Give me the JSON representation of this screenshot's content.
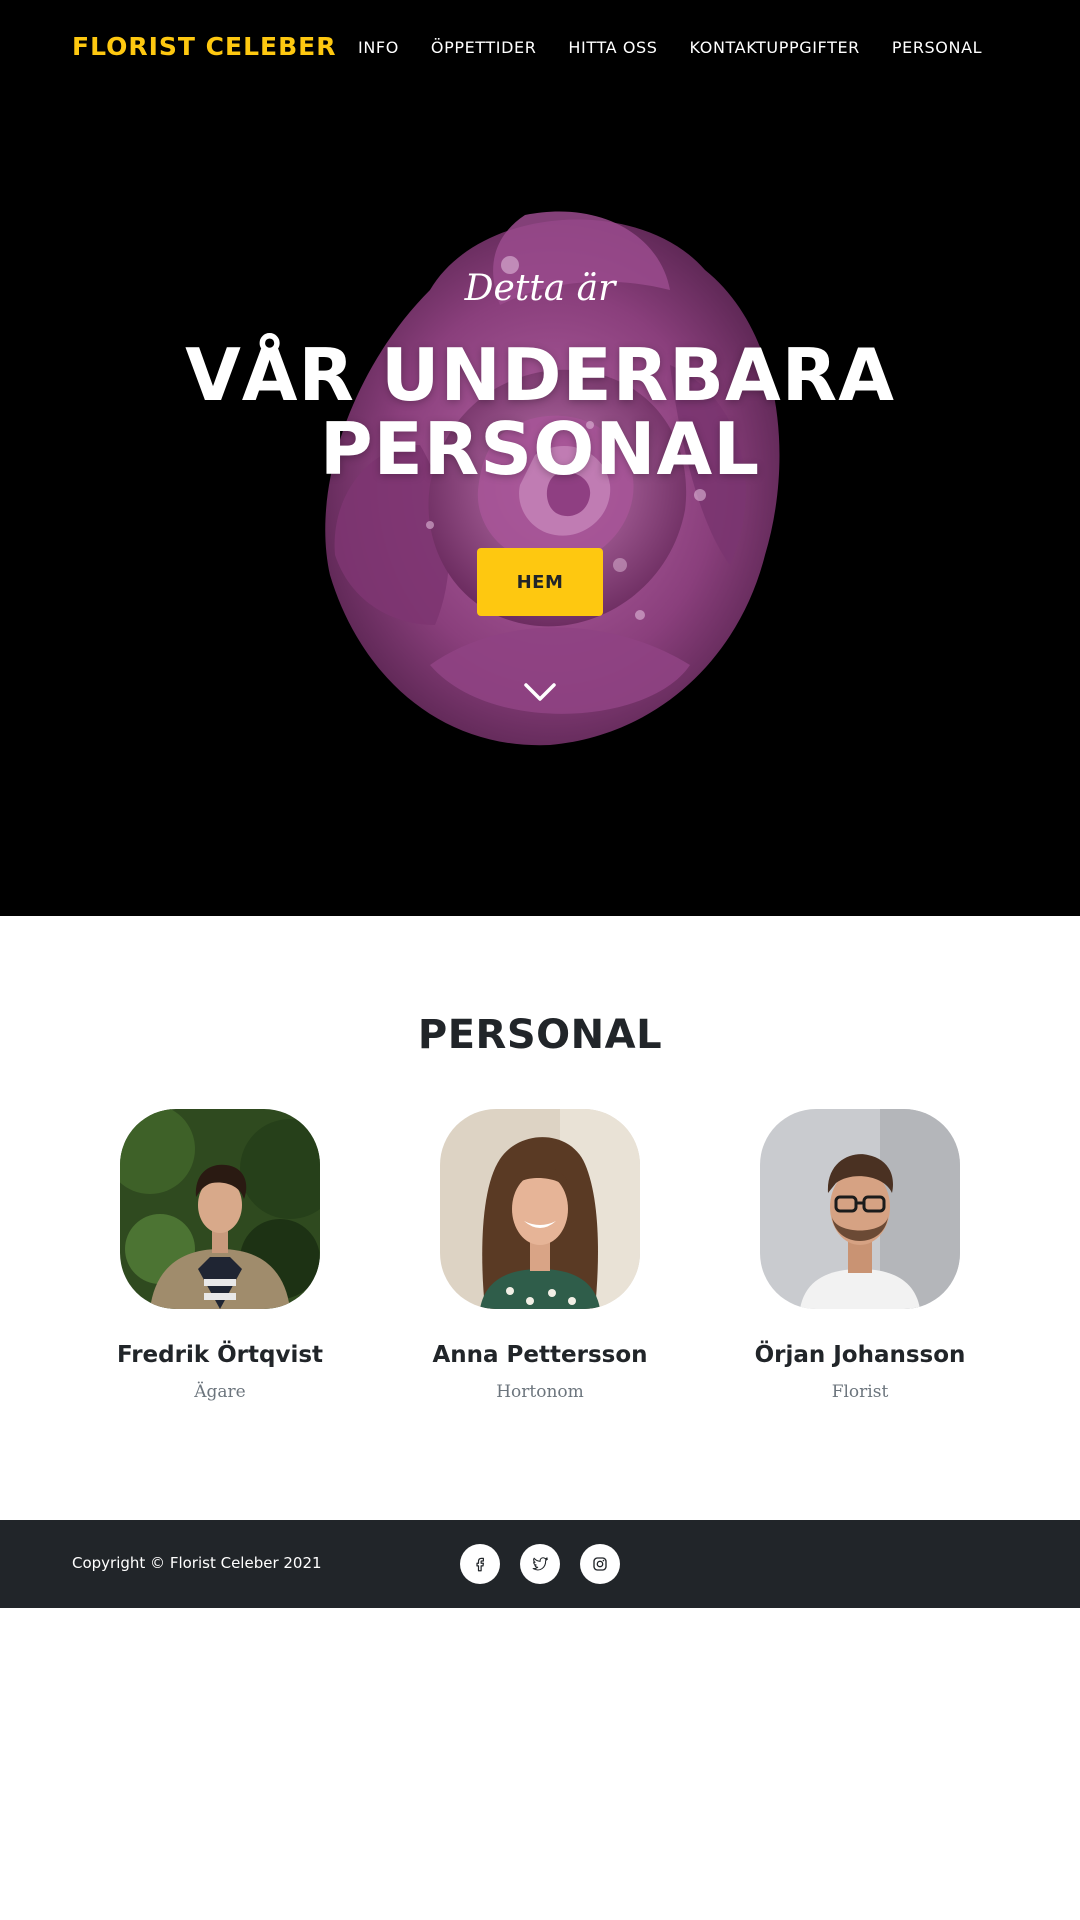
{
  "navbar": {
    "brand": "FLORIST CELEBER",
    "links": [
      {
        "label": "INFO"
      },
      {
        "label": "ÖPPETTIDER"
      },
      {
        "label": "HITTA OSS"
      },
      {
        "label": "KONTAKTUPPGIFTER"
      },
      {
        "label": "PERSONAL"
      }
    ]
  },
  "hero": {
    "subheading": "Detta är",
    "heading_line1": "VÅR UNDERBARA",
    "heading_line2": "PERSONAL",
    "button_label": "HEM",
    "background_image": "purple-rose",
    "scroll_icon": "chevron-down-icon"
  },
  "team": {
    "heading": "PERSONAL",
    "members": [
      {
        "name": "Fredrik Örtqvist",
        "role": "Ägare"
      },
      {
        "name": "Anna Pettersson",
        "role": "Hortonom"
      },
      {
        "name": "Örjan Johansson",
        "role": "Florist"
      }
    ]
  },
  "footer": {
    "copyright": "Copyright © Florist Celeber 2021",
    "social_icons": [
      "facebook-icon",
      "twitter-icon",
      "instagram-icon"
    ]
  },
  "colors": {
    "accent": "#fec810",
    "hero_background": "#000000",
    "footer_background": "#212529",
    "heading_text": "#212529",
    "muted_text": "#6c757d"
  }
}
